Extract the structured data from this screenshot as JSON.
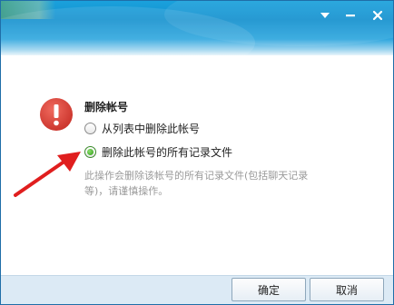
{
  "dialog": {
    "heading": "删除帐号",
    "options": [
      {
        "label": "从列表中删除此帐号",
        "checked": false
      },
      {
        "label": "删除此帐号的所有记录文件",
        "checked": true
      }
    ],
    "description": "此操作会删除该帐号的所有记录文件(包括聊天记录等)，请谨慎操作。"
  },
  "buttons": {
    "ok": "确定",
    "cancel": "取消"
  },
  "titlebar": {
    "icons": [
      "menu-dropdown-icon",
      "minimize-icon",
      "close-icon"
    ]
  },
  "colors": {
    "header": "#1591cf",
    "alert": "#e04a3f",
    "arrow": "#e01e1e",
    "radio_checked": "#2f9a18",
    "footer": "#dceaf5"
  }
}
